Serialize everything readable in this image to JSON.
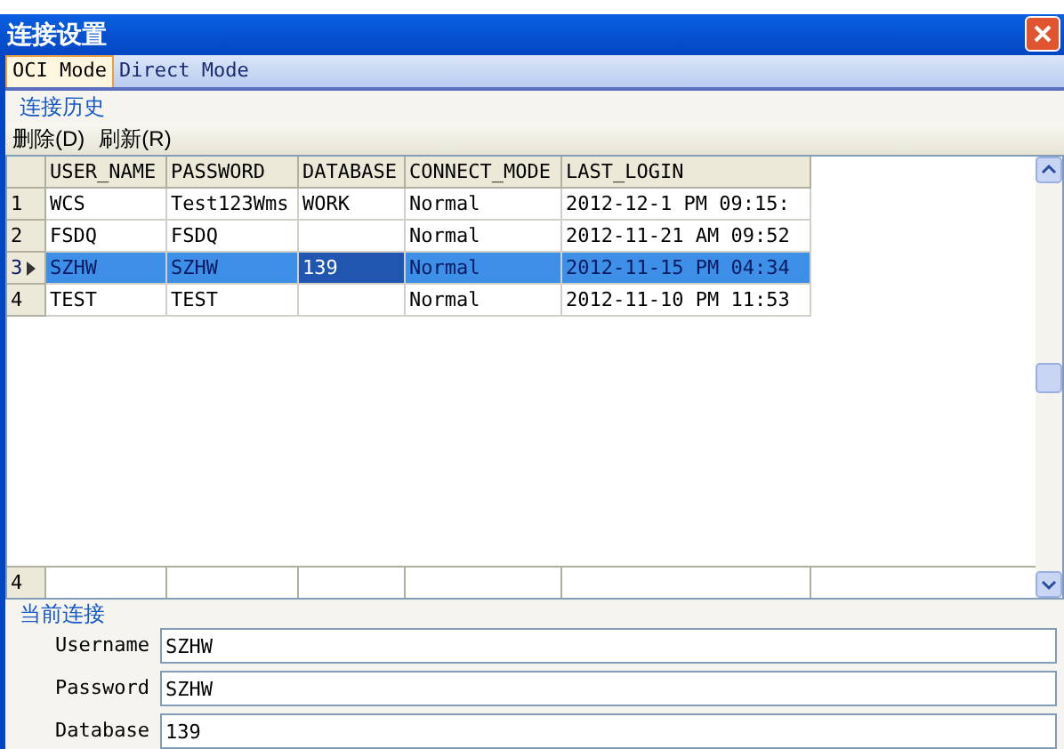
{
  "window": {
    "title": "连接设置"
  },
  "tabs": [
    {
      "label": "OCI Mode",
      "selected": true
    },
    {
      "label": "Direct Mode",
      "selected": false
    }
  ],
  "history_group": {
    "title": "连接历史"
  },
  "toolbar": [
    "删除(D)",
    "刷新(R)"
  ],
  "table": {
    "columns": [
      "USER_NAME",
      "PASSWORD",
      "DATABASE",
      "CONNECT_MODE",
      "LAST_LOGIN"
    ],
    "rows": [
      {
        "number": "1",
        "selected": false,
        "cells": [
          {
            "text": "WCS",
            "focused": false
          },
          {
            "text": "Test123Wms",
            "focused": false
          },
          {
            "text": "WORK",
            "focused": false
          },
          {
            "text": "Normal",
            "focused": false
          },
          {
            "text": "2012-12-1 PM 09:15:",
            "focused": false
          }
        ]
      },
      {
        "number": "2",
        "selected": false,
        "cells": [
          {
            "text": "FSDQ",
            "focused": false
          },
          {
            "text": "FSDQ",
            "focused": false
          },
          {
            "text": "",
            "focused": false
          },
          {
            "text": "Normal",
            "focused": false
          },
          {
            "text": "2012-11-21 AM 09:52",
            "focused": false
          }
        ]
      },
      {
        "number": "3",
        "selected": true,
        "cells": [
          {
            "text": "SZHW",
            "focused": false
          },
          {
            "text": "SZHW",
            "focused": false
          },
          {
            "text": "139",
            "focused": true
          },
          {
            "text": "Normal",
            "focused": false
          },
          {
            "text": "2012-11-15 PM 04:34",
            "focused": false
          }
        ]
      },
      {
        "number": "4",
        "selected": false,
        "cells": [
          {
            "text": "TEST",
            "focused": false
          },
          {
            "text": "TEST",
            "focused": false
          },
          {
            "text": "",
            "focused": false
          },
          {
            "text": "Normal",
            "focused": false
          },
          {
            "text": "2012-11-10 PM 11:53",
            "focused": false
          }
        ]
      }
    ],
    "footer": {
      "count": "4"
    }
  },
  "current_group": {
    "title": "当前连接",
    "fields": [
      {
        "label": "Username",
        "value": "SZHW"
      },
      {
        "label": "Password",
        "value": "SZHW"
      },
      {
        "label": "Database",
        "value": "139"
      }
    ]
  }
}
